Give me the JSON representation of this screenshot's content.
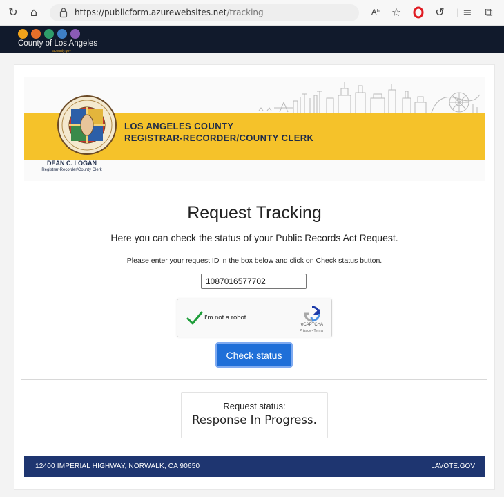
{
  "browser": {
    "url_host": "https://publicform.azurewebsites.net",
    "url_path": "/tracking"
  },
  "county_logo": {
    "name": "County of Los Angeles",
    "sub": "lacounty.gov"
  },
  "banner": {
    "line1": "LOS ANGELES COUNTY",
    "line2": "REGISTRAR-RECORDER/COUNTY CLERK",
    "official_name": "DEAN C. LOGAN",
    "official_title": "Registrar-Recorder/County Clerk"
  },
  "main": {
    "title": "Request Tracking",
    "subtitle": "Here you can check the status of your Public Records Act Request.",
    "instruction": "Please enter your request ID in the box below and click on Check status button.",
    "request_id": "1087016577702",
    "button_label": "Check status"
  },
  "captcha": {
    "label": "I'm not a robot",
    "brand": "reCAPTCHA",
    "links": "Privacy - Terms"
  },
  "status": {
    "label": "Request status:",
    "value": "Response In Progress."
  },
  "footer": {
    "address": "12400 IMPERIAL HIGHWAY, NORWALK, CA 90650",
    "site": "LAVOTE.GOV"
  },
  "colors": {
    "county_bar": "#111a2c",
    "banner_yellow": "#f5c22a",
    "primary_button": "#1f6fd8",
    "footer": "#1e3570"
  }
}
